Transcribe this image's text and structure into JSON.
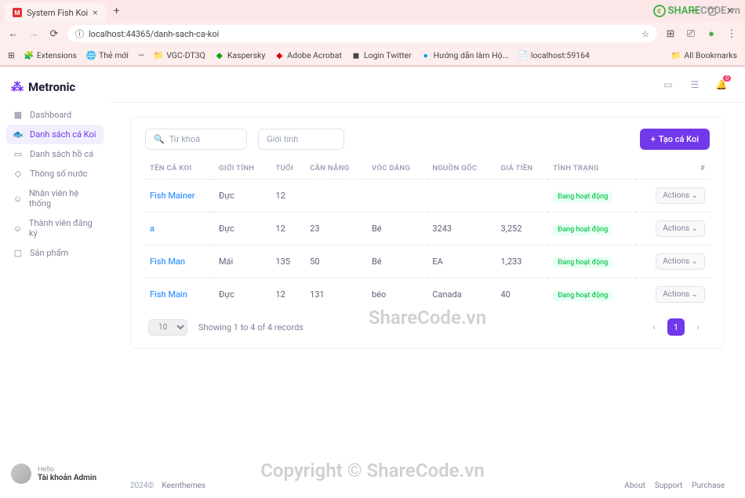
{
  "browser": {
    "tab_title": "System Fish Koi",
    "url": "localhost:44365/danh-sach-ca-koi",
    "bookmarks": [
      "Extensions",
      "Thẻ mới",
      "VGC-DT3Q",
      "Kaspersky",
      "Adobe Acrobat",
      "Login Twitter",
      "Hướng dẫn làm Hộ...",
      "localhost:59164"
    ],
    "all_bookmarks": "All Bookmarks"
  },
  "brand": "Metronic",
  "sidebar": {
    "items": [
      {
        "label": "Dashboard"
      },
      {
        "label": "Danh sách cá Koi"
      },
      {
        "label": "Danh sách hồ cá"
      },
      {
        "label": "Thông số nước"
      },
      {
        "label": "Nhân viên hệ thống"
      },
      {
        "label": "Thành viên đăng ký"
      },
      {
        "label": "Sản phẩm"
      }
    ]
  },
  "user": {
    "hello": "Hello",
    "name": "Tài khoản Admin"
  },
  "notif_count": "0",
  "filters": {
    "search_placeholder": "Từ khoá",
    "gender_placeholder": "Giới tính",
    "create_btn": "Tạo cá Koi"
  },
  "table": {
    "headers": [
      "TÊN CÁ KOI",
      "GIỚI TÍNH",
      "TUỔI",
      "CÂN NẶNG",
      "VÓC DÁNG",
      "NGUỒN GỐC",
      "GIÁ TIỀN",
      "TÌNH TRẠNG",
      "#"
    ],
    "rows": [
      {
        "name": "Fish Mainer",
        "sex": "Đực",
        "age": "12",
        "weight": "",
        "shape": "",
        "origin": "",
        "price": "",
        "status": "Đang hoạt động"
      },
      {
        "name": "a",
        "sex": "Đực",
        "age": "12",
        "weight": "23",
        "shape": "Bé",
        "origin": "3243",
        "price": "3,252",
        "status": "Đang hoạt động"
      },
      {
        "name": "Fish Man",
        "sex": "Mái",
        "age": "135",
        "weight": "50",
        "shape": "Bé",
        "origin": "EA",
        "price": "1,233",
        "status": "Đang hoạt động"
      },
      {
        "name": "Fish Main",
        "sex": "Đực",
        "age": "12",
        "weight": "131",
        "shape": "béo",
        "origin": "Canada",
        "price": "40",
        "status": "Đang hoạt động"
      }
    ],
    "actions_label": "Actions",
    "page_size": "10",
    "showing": "Showing 1 to 4 of 4 records",
    "current_page": "1"
  },
  "footer": {
    "year": "2024©",
    "vendor": "Keenthemes",
    "links": [
      "About",
      "Support",
      "Purchase"
    ]
  },
  "watermark1": "ShareCode.vn",
  "watermark2": "Copyright © ShareCode.vn",
  "sharecode": "SHARECODE.vn"
}
